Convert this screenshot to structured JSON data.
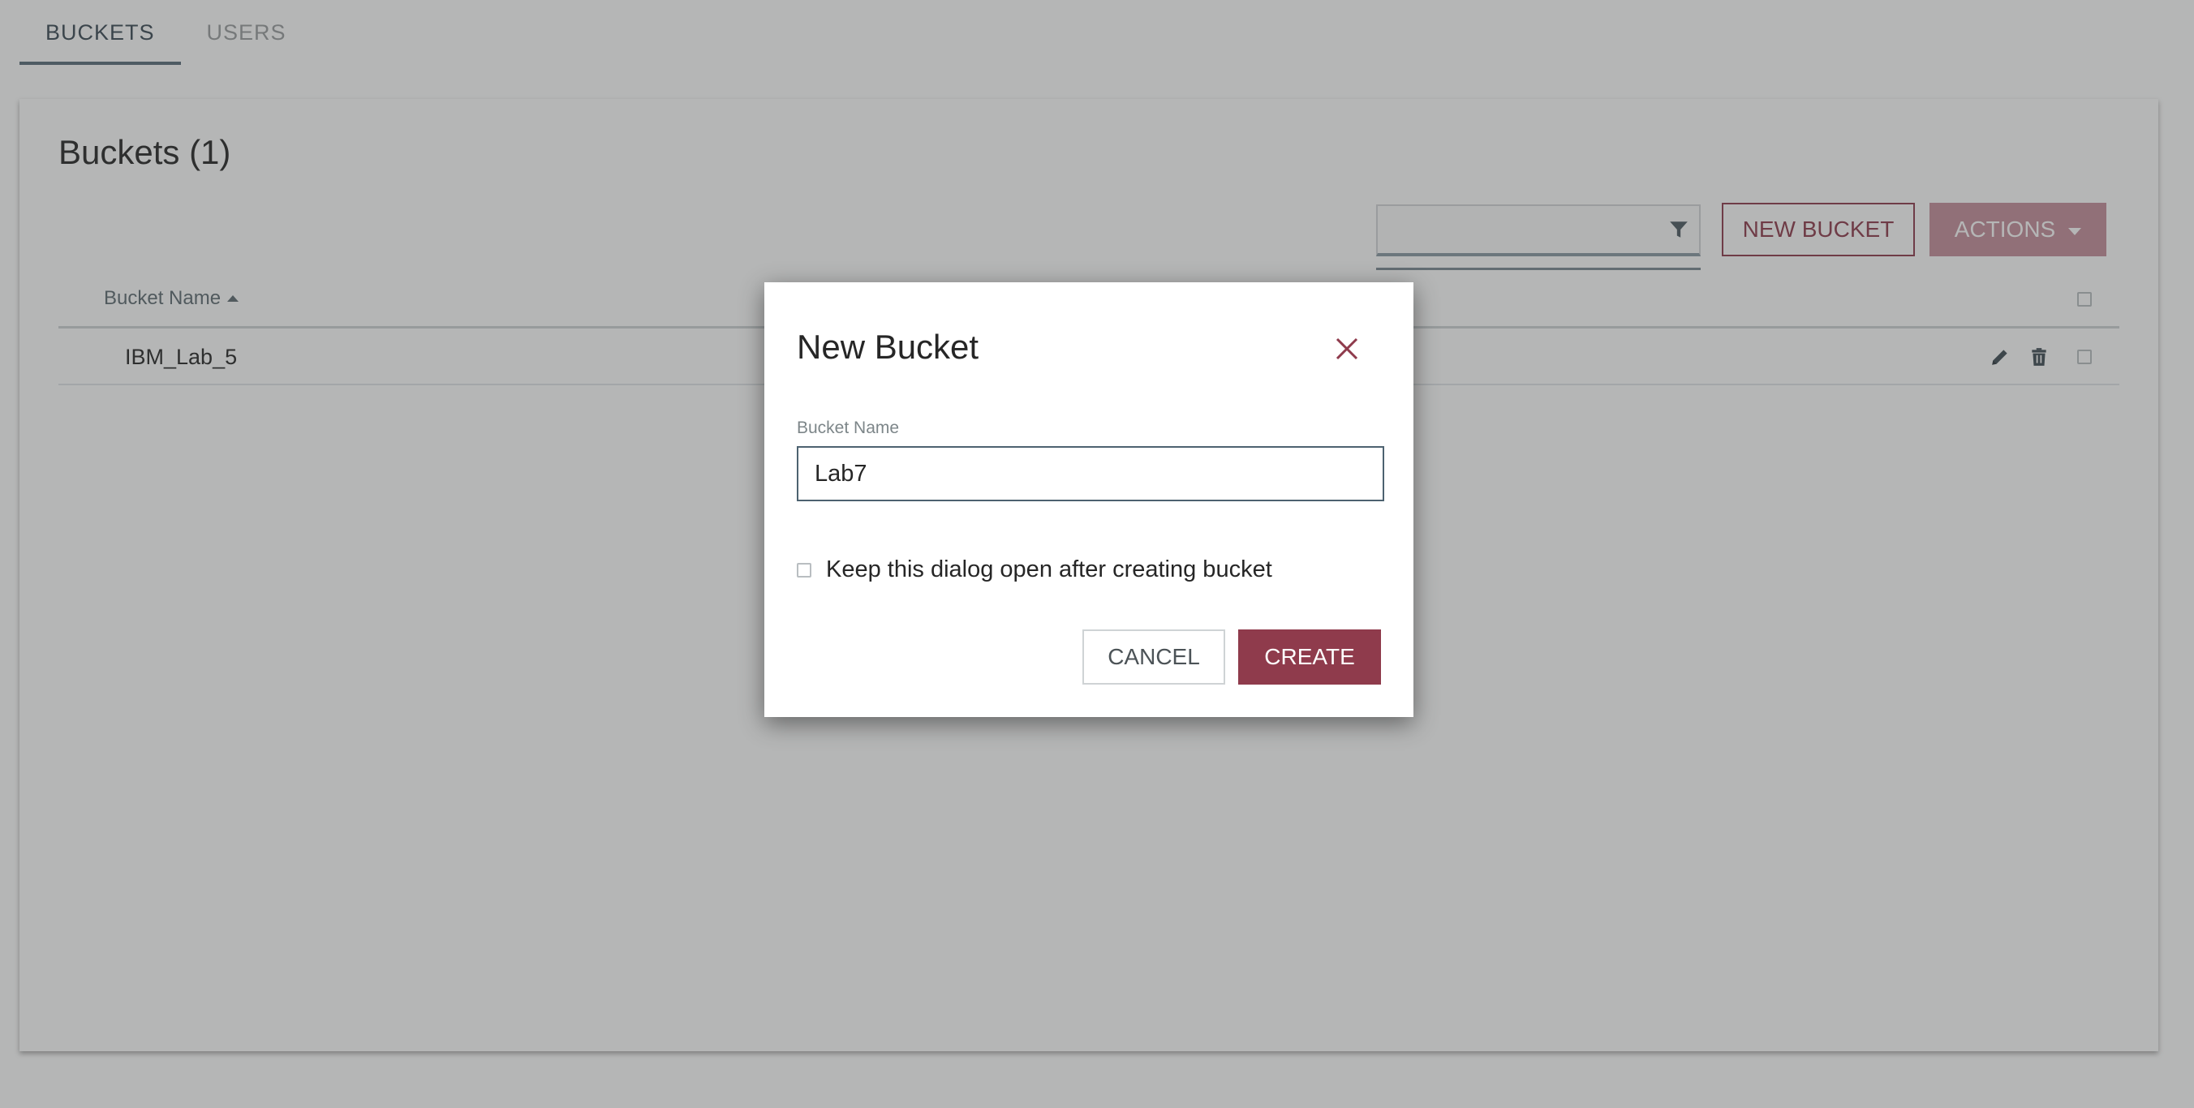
{
  "tabs": [
    {
      "label": "BUCKETS",
      "active": true
    },
    {
      "label": "USERS",
      "active": false
    }
  ],
  "card": {
    "title": "Buckets (1)",
    "filter": {
      "value": "",
      "icon": "filter-icon"
    },
    "new_bucket_label": "NEW BUCKET",
    "actions_label": "ACTIONS"
  },
  "table": {
    "columns": [
      {
        "label": "Bucket Name",
        "sort": "ascending"
      }
    ],
    "rows": [
      {
        "name": "IBM_Lab_5"
      }
    ]
  },
  "dialog": {
    "title": "New Bucket",
    "field_label": "Bucket Name",
    "field_value": "Lab7",
    "keep_open_label": "Keep this dialog open after creating bucket",
    "keep_open_checked": false,
    "cancel_label": "CANCEL",
    "create_label": "CREATE"
  },
  "colors": {
    "accent": "#8f3b4c",
    "actions_disabled": "#c58f9b",
    "tab_active": "#3b4a54"
  }
}
